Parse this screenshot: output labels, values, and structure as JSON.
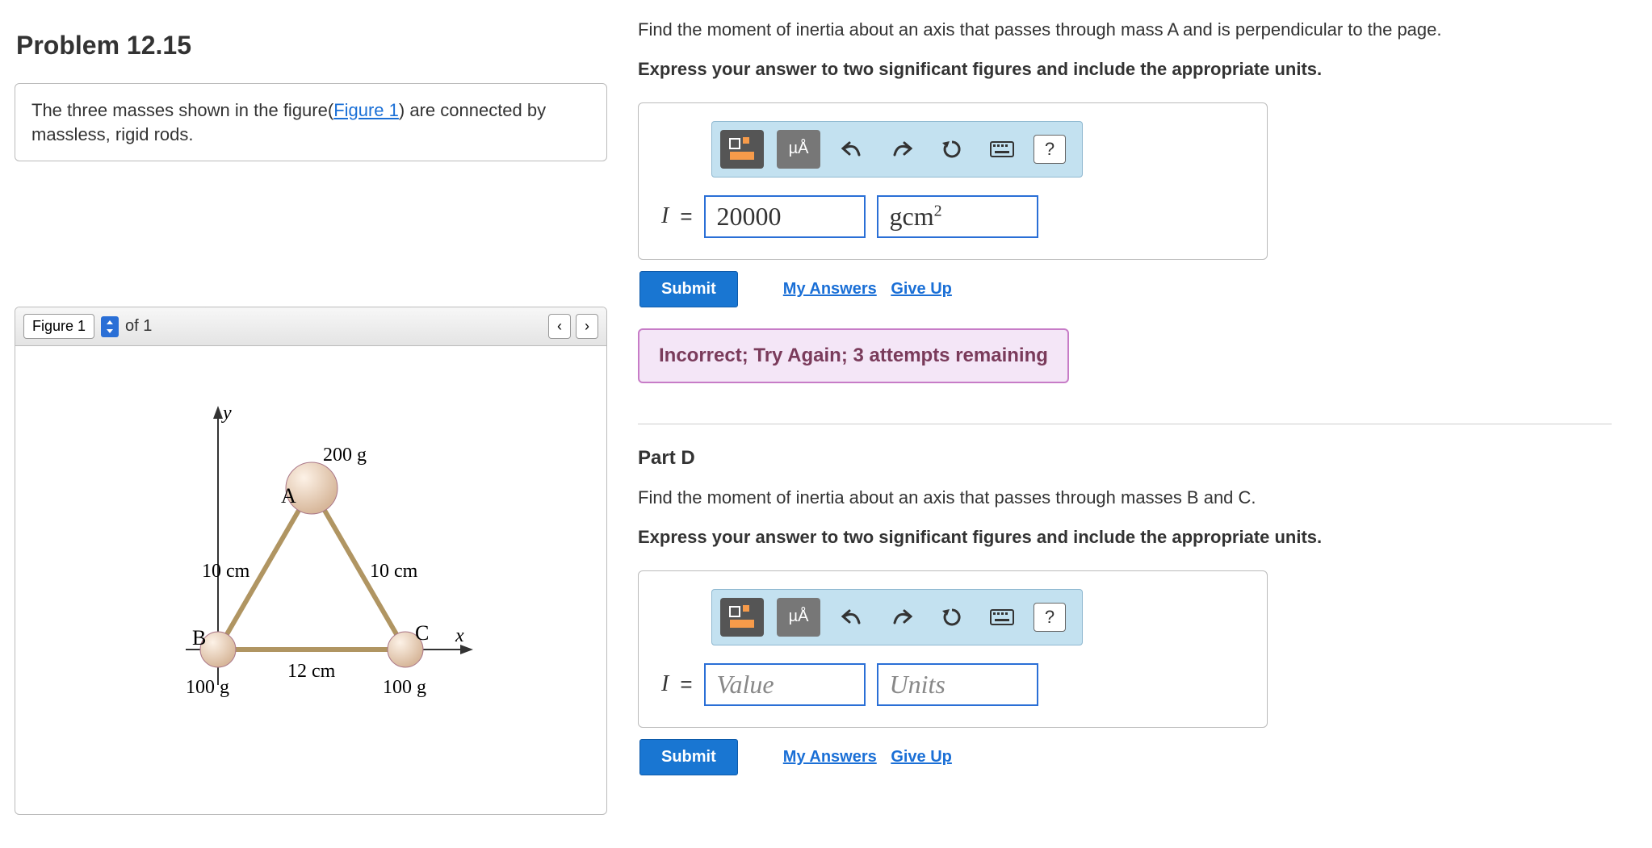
{
  "problem": {
    "title": "Problem 12.15",
    "intro_pre": "The three masses shown in the figure(",
    "intro_link": "Figure 1",
    "intro_post": ") are connected by massless, rigid rods."
  },
  "figure": {
    "button_label": "Figure 1",
    "count_label": "of 1",
    "labels": {
      "y": "y",
      "x": "x",
      "A": "A",
      "B": "B",
      "C": "C",
      "massA": "200 g",
      "massB": "100 g",
      "massC": "100 g",
      "lenAB": "10 cm",
      "lenAC": "10 cm",
      "lenBC": "12 cm"
    }
  },
  "partC": {
    "question": "Find the moment of inertia about an axis that passes through mass A and is perpendicular to the page.",
    "instruction": "Express your answer to two significant figures and include the appropriate units.",
    "var": "I",
    "eq": "=",
    "value": "20000",
    "units_html": "gcm²",
    "toolbar_units_label": "µÅ",
    "submit": "Submit",
    "my_answers": "My Answers",
    "give_up": "Give Up",
    "feedback": "Incorrect; Try Again; 3 attempts remaining"
  },
  "partD": {
    "label": "Part D",
    "question": "Find the moment of inertia about an axis that passes through masses B and C.",
    "instruction": "Express your answer to two significant figures and include the appropriate units.",
    "var": "I",
    "eq": "=",
    "value_placeholder": "Value",
    "units_placeholder": "Units",
    "toolbar_units_label": "µÅ",
    "submit": "Submit",
    "my_answers": "My Answers",
    "give_up": "Give Up"
  }
}
